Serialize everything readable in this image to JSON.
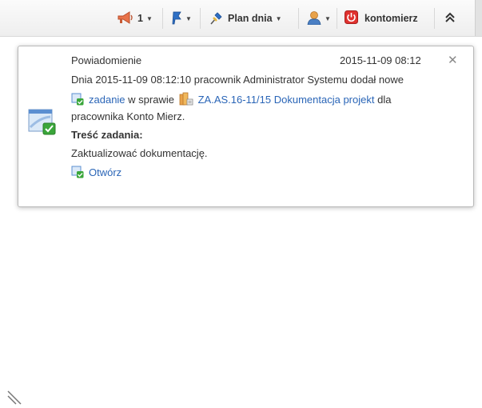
{
  "toolbar": {
    "announcements_count": "1",
    "plan_label": "Plan dnia",
    "user_label": "kontomierz"
  },
  "notification": {
    "title": "Powiadomienie",
    "date": "2015-11-09 08:12",
    "line1": "Dnia 2015-11-09 08:12:10 pracownik Administrator Systemu dodał nowe",
    "task_link": "zadanie",
    "in_case_text": "w sprawie",
    "case_link": "ZA.AS.16-11/15 Dokumentacja projekt",
    "for_text": "dla",
    "line3": "pracownika Konto Mierz.",
    "content_label": "Treść zadania:",
    "content": "Zaktualizować dokumentację.",
    "open_link": "Otwórz"
  },
  "colors": {
    "link": "#2a65b7",
    "power_red": "#e0322f",
    "task_check_green": "#3aa63a"
  },
  "icons": [
    "megaphone-icon",
    "flag-icon",
    "pin-icon",
    "user-icon",
    "power-icon",
    "collapse-icon",
    "task-icon",
    "case-folder-icon",
    "close-icon",
    "resize-handle-icon"
  ]
}
